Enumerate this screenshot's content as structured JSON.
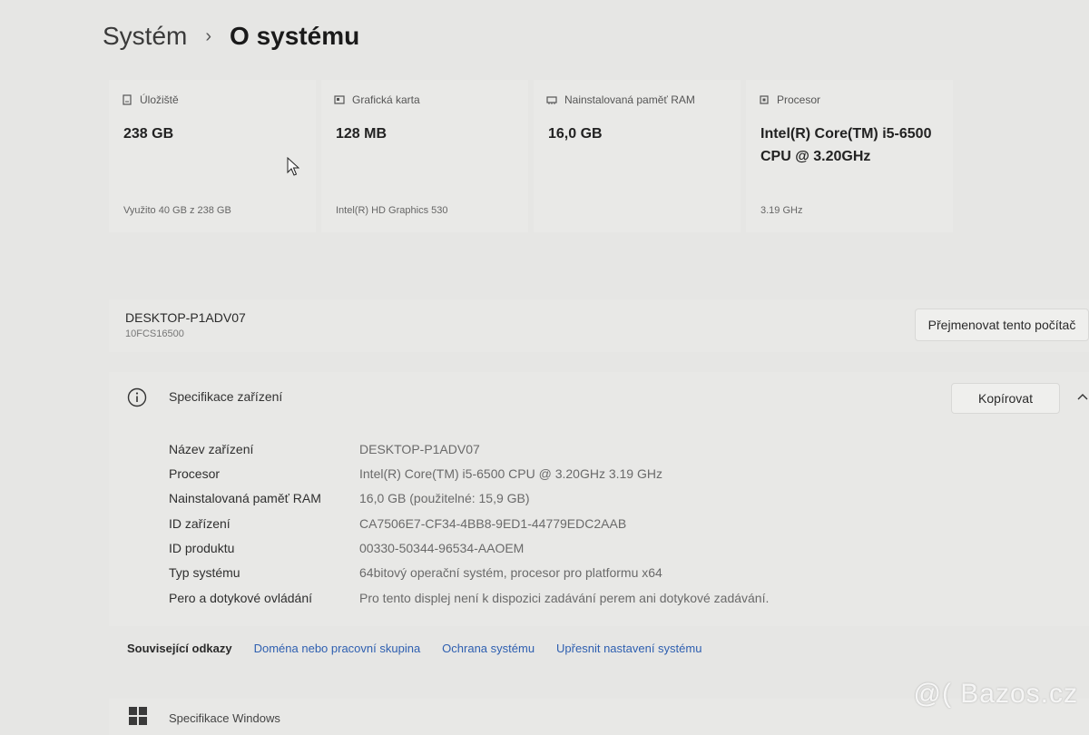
{
  "breadcrumb": {
    "parent": "Systém",
    "separator": "›",
    "current": "O systému"
  },
  "tiles": [
    {
      "icon": "storage-icon",
      "label": "Úložiště",
      "value": "238 GB",
      "sub": "Využito 40 GB z 238 GB"
    },
    {
      "icon": "graphics-card-icon",
      "label": "Grafická karta",
      "value": "128 MB",
      "sub": "Intel(R) HD Graphics 530"
    },
    {
      "icon": "ram-icon",
      "label": "Nainstalovaná paměť RAM",
      "value": "16,0 GB",
      "sub": ""
    },
    {
      "icon": "processor-icon",
      "label": "Procesor",
      "value": "Intel(R) Core(TM) i5-6500 CPU @ 3.20GHz",
      "sub": "3.19 GHz"
    }
  ],
  "device": {
    "name": "DESKTOP-P1ADV07",
    "model": "10FCS16500",
    "rename_label": "Přejmenovat tento počítač"
  },
  "specs": {
    "title": "Specifikace zařízení",
    "copy_label": "Kopírovat",
    "rows": [
      {
        "label": "Název zařízení",
        "value": "DESKTOP-P1ADV07"
      },
      {
        "label": "Procesor",
        "value": "Intel(R) Core(TM) i5-6500 CPU @ 3.20GHz   3.19 GHz"
      },
      {
        "label": "Nainstalovaná paměť RAM",
        "value": "16,0 GB (použitelné: 15,9 GB)"
      },
      {
        "label": "ID zařízení",
        "value": "CA7506E7-CF34-4BB8-9ED1-44779EDC2AAB"
      },
      {
        "label": "ID produktu",
        "value": "00330-50344-96534-AAOEM"
      },
      {
        "label": "Typ systému",
        "value": "64bitový operační systém, procesor pro platformu x64"
      },
      {
        "label": "Pero a dotykové ovládání",
        "value": "Pro tento displej není k dispozici zadávání perem ani dotykové zadávání."
      }
    ]
  },
  "related": {
    "title": "Související odkazy",
    "links": [
      "Doména nebo pracovní skupina",
      "Ochrana systému",
      "Upřesnit nastavení systému"
    ]
  },
  "windows_spec": {
    "title": "Specifikace Windows"
  },
  "watermark": "@( Bazos.cz"
}
